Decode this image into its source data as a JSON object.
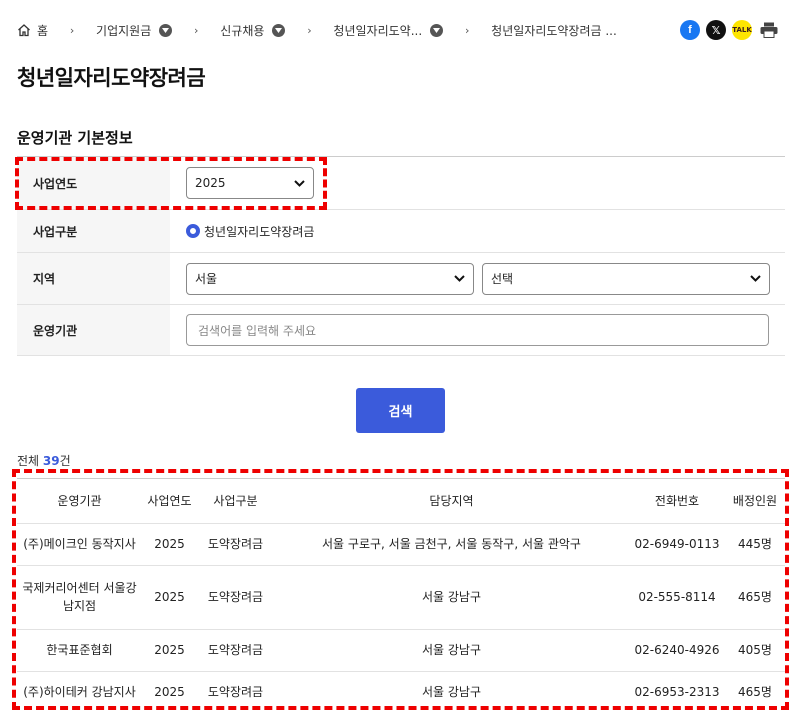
{
  "breadcrumb": {
    "home": "홈",
    "items": [
      "기업지원금",
      "신규채용",
      "청년일자리도약...",
      "청년일자리도약장려금 ..."
    ]
  },
  "share": {
    "facebook": "f",
    "x": "𝕏",
    "kakao": "TALK"
  },
  "page_title": "청년일자리도약장려금",
  "section_title": "운영기관 기본정보",
  "form": {
    "year_label": "사업연도",
    "year_value": "2025",
    "type_label": "사업구분",
    "type_option": "청년일자리도약장려금",
    "region_label": "지역",
    "region_value": "서울",
    "region_sub_value": "선택",
    "org_label": "운영기관",
    "org_placeholder": "검색어를 입력해 주세요"
  },
  "search_button": "검색",
  "total": {
    "prefix": "전체 ",
    "count": "39",
    "suffix": "건"
  },
  "table": {
    "headers": [
      "운영기관",
      "사업연도",
      "사업구분",
      "담당지역",
      "전화번호",
      "배정인원"
    ],
    "rows": [
      [
        "(주)메이크인 동작지사",
        "2025",
        "도약장려금",
        "서울 구로구, 서울 금천구, 서울 동작구, 서울 관악구",
        "02-6949-0113",
        "445명"
      ],
      [
        "국제커리어센터 서울강남지점",
        "2025",
        "도약장려금",
        "서울 강남구",
        "02-555-8114",
        "465명"
      ],
      [
        "한국표준협회",
        "2025",
        "도약장려금",
        "서울 강남구",
        "02-6240-4926",
        "405명"
      ],
      [
        "(주)하이테커 강남지사",
        "2025",
        "도약장려금",
        "서울 강남구",
        "02-6953-2313",
        "465명"
      ]
    ]
  },
  "colors": {
    "accent": "#3b5bdb",
    "highlight": "#ee0000"
  }
}
